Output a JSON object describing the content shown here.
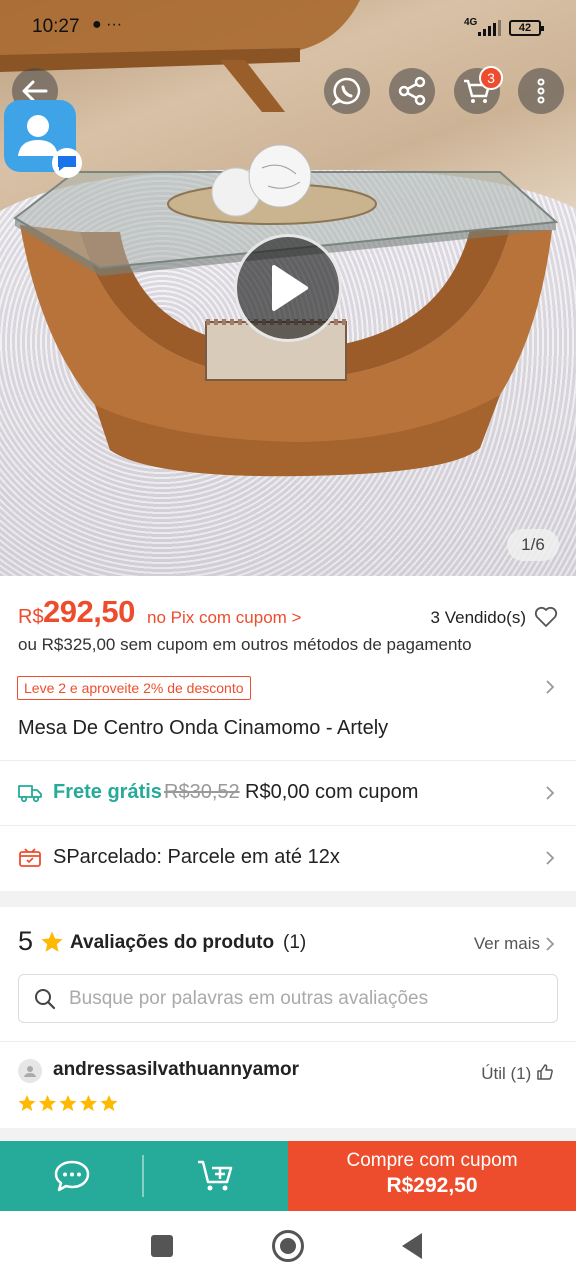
{
  "status_bar": {
    "time": "10:27",
    "extra_icons": "●  ···",
    "network": "4G",
    "battery": "42"
  },
  "header": {
    "cart_badge": "3",
    "back_icon": "arrow-left-icon",
    "share_icon": "share-icon",
    "cart_icon": "cart-icon",
    "more_icon": "more-vertical-icon"
  },
  "gallery": {
    "page_indicator": "1/6",
    "current_page": 1,
    "total_pages": 6
  },
  "price": {
    "currency": "R$",
    "value": "292,50",
    "pix_label": "no Pix com cupom >",
    "sold": "3 Vendido(s)",
    "alt_price": "ou R$325,00 sem cupom em outros métodos de pagamento"
  },
  "promo": {
    "tag": "Leve 2 e aproveite 2% de desconto"
  },
  "product": {
    "title": "Mesa De Centro Onda Cinamomo - Artely"
  },
  "shipping": {
    "free_label": "Frete grátis",
    "old_price": "R$30,52",
    "new_price": "R$0,00 com cupom"
  },
  "installments": {
    "text": "SParcelado: Parcele em até 12x"
  },
  "reviews": {
    "rating": "5",
    "label": "Avaliações do produto",
    "count": "(1)",
    "see_more": "Ver mais",
    "search_placeholder": "Busque por palavras em outras avaliações",
    "items": [
      {
        "user": "andressasilvathuannyamor",
        "helpful": "Útil (1)",
        "stars": 5
      }
    ]
  },
  "bottom_bar": {
    "buy_label": "Compre com cupom",
    "buy_price": "R$292,50"
  },
  "colors": {
    "accent": "#ee4d2d",
    "teal": "#26aa99",
    "star": "#ffb900"
  }
}
